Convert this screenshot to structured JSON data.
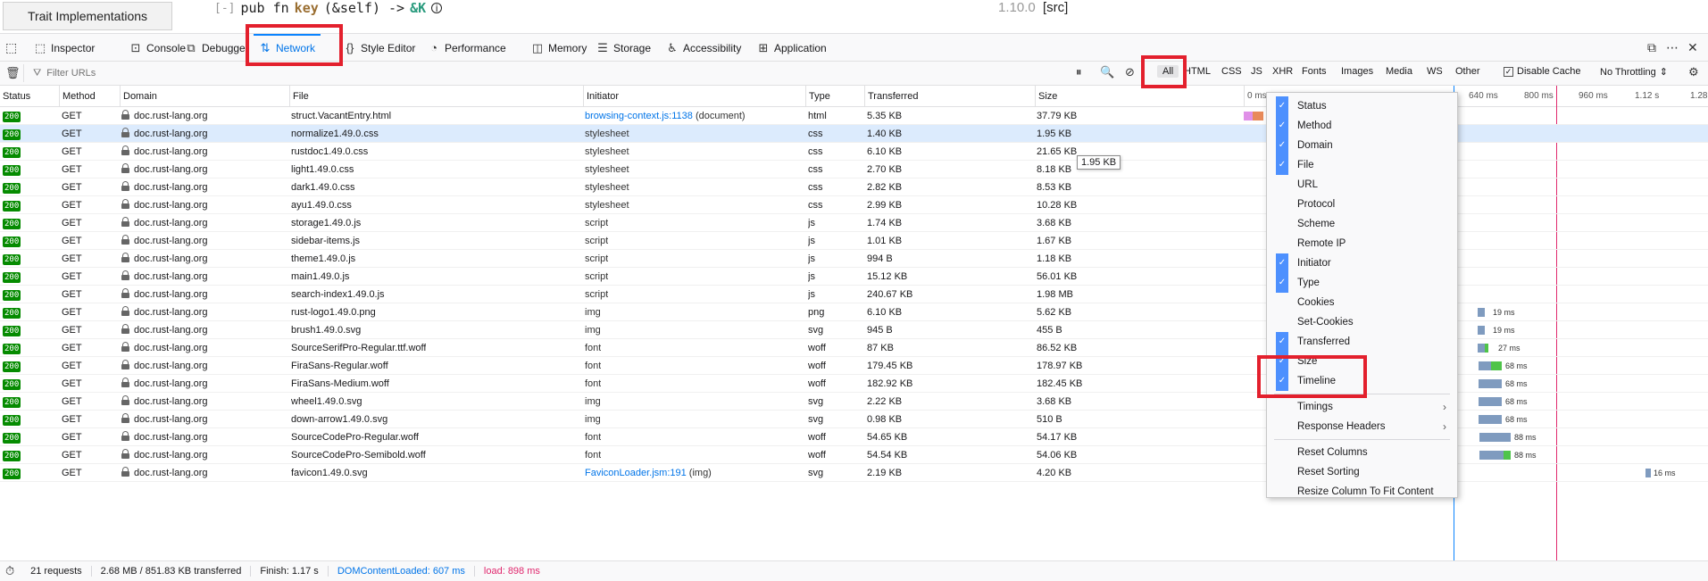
{
  "doc": {
    "sidebar_button": "Trait Implementations",
    "toggle": "[-]",
    "code_prefix": "pub fn",
    "fn_name": "key",
    "code_args": "(&self) ->",
    "ret_type": "&K",
    "info": "i",
    "version": "1.10.0",
    "src": "[src]"
  },
  "tabs": [
    {
      "label": "Inspector",
      "icon": "inspector-icon"
    },
    {
      "label": "Console",
      "icon": "console-icon"
    },
    {
      "label": "Debugger",
      "icon": "debugger-icon"
    },
    {
      "label": "Network",
      "icon": "network-icon",
      "active": true
    },
    {
      "label": "Style Editor",
      "icon": "style-editor-icon"
    },
    {
      "label": "Performance",
      "icon": "performance-icon"
    },
    {
      "label": "Memory",
      "icon": "memory-icon"
    },
    {
      "label": "Storage",
      "icon": "storage-icon"
    },
    {
      "label": "Accessibility",
      "icon": "accessibility-icon"
    },
    {
      "label": "Application",
      "icon": "application-icon"
    }
  ],
  "toolbar": {
    "filter_placeholder": "Filter URLs",
    "types": [
      "All",
      "HTML",
      "CSS",
      "JS",
      "XHR",
      "Fonts",
      "Images",
      "Media",
      "WS",
      "Other"
    ],
    "disable_cache": "Disable Cache",
    "throttling": "No Throttling"
  },
  "columns": {
    "status": "Status",
    "method": "Method",
    "domain": "Domain",
    "file": "File",
    "initiator": "Initiator",
    "type": "Type",
    "transferred": "Transferred",
    "size": "Size"
  },
  "waterfall_ticks": [
    "0 ms",
    "640 ms",
    "800 ms",
    "960 ms",
    "1.12 s",
    "1.28"
  ],
  "rows": [
    {
      "status": "200",
      "method": "GET",
      "domain": "doc.rust-lang.org",
      "file": "struct.VacantEntry.html",
      "initiator_link": "browsing-context.js:1138",
      "initiator_rest": "(document)",
      "type": "html",
      "transferred": "5.35 KB",
      "size": "37.79 KB",
      "timing": ""
    },
    {
      "status": "200",
      "method": "GET",
      "domain": "doc.rust-lang.org",
      "file": "normalize1.49.0.css",
      "initiator_link": "",
      "initiator_rest": "stylesheet",
      "type": "css",
      "transferred": "1.40 KB",
      "size": "1.95 KB",
      "timing": ""
    },
    {
      "status": "200",
      "method": "GET",
      "domain": "doc.rust-lang.org",
      "file": "rustdoc1.49.0.css",
      "initiator_link": "",
      "initiator_rest": "stylesheet",
      "type": "css",
      "transferred": "6.10 KB",
      "size": "21.65 KB",
      "timing": ""
    },
    {
      "status": "200",
      "method": "GET",
      "domain": "doc.rust-lang.org",
      "file": "light1.49.0.css",
      "initiator_link": "",
      "initiator_rest": "stylesheet",
      "type": "css",
      "transferred": "2.70 KB",
      "size": "8.18 KB",
      "timing": ""
    },
    {
      "status": "200",
      "method": "GET",
      "domain": "doc.rust-lang.org",
      "file": "dark1.49.0.css",
      "initiator_link": "",
      "initiator_rest": "stylesheet",
      "type": "css",
      "transferred": "2.82 KB",
      "size": "8.53 KB",
      "timing": ""
    },
    {
      "status": "200",
      "method": "GET",
      "domain": "doc.rust-lang.org",
      "file": "ayu1.49.0.css",
      "initiator_link": "",
      "initiator_rest": "stylesheet",
      "type": "css",
      "transferred": "2.99 KB",
      "size": "10.28 KB",
      "timing": ""
    },
    {
      "status": "200",
      "method": "GET",
      "domain": "doc.rust-lang.org",
      "file": "storage1.49.0.js",
      "initiator_link": "",
      "initiator_rest": "script",
      "type": "js",
      "transferred": "1.74 KB",
      "size": "3.68 KB",
      "timing": ""
    },
    {
      "status": "200",
      "method": "GET",
      "domain": "doc.rust-lang.org",
      "file": "sidebar-items.js",
      "initiator_link": "",
      "initiator_rest": "script",
      "type": "js",
      "transferred": "1.01 KB",
      "size": "1.67 KB",
      "timing": ""
    },
    {
      "status": "200",
      "method": "GET",
      "domain": "doc.rust-lang.org",
      "file": "theme1.49.0.js",
      "initiator_link": "",
      "initiator_rest": "script",
      "type": "js",
      "transferred": "994 B",
      "size": "1.18 KB",
      "timing": ""
    },
    {
      "status": "200",
      "method": "GET",
      "domain": "doc.rust-lang.org",
      "file": "main1.49.0.js",
      "initiator_link": "",
      "initiator_rest": "script",
      "type": "js",
      "transferred": "15.12 KB",
      "size": "56.01 KB",
      "timing": ""
    },
    {
      "status": "200",
      "method": "GET",
      "domain": "doc.rust-lang.org",
      "file": "search-index1.49.0.js",
      "initiator_link": "",
      "initiator_rest": "script",
      "type": "js",
      "transferred": "240.67 KB",
      "size": "1.98 MB",
      "timing": ""
    },
    {
      "status": "200",
      "method": "GET",
      "domain": "doc.rust-lang.org",
      "file": "rust-logo1.49.0.png",
      "initiator_link": "",
      "initiator_rest": "img",
      "type": "png",
      "transferred": "6.10 KB",
      "size": "5.62 KB",
      "timing": "19 ms"
    },
    {
      "status": "200",
      "method": "GET",
      "domain": "doc.rust-lang.org",
      "file": "brush1.49.0.svg",
      "initiator_link": "",
      "initiator_rest": "img",
      "type": "svg",
      "transferred": "945 B",
      "size": "455 B",
      "timing": "19 ms"
    },
    {
      "status": "200",
      "method": "GET",
      "domain": "doc.rust-lang.org",
      "file": "SourceSerifPro-Regular.ttf.woff",
      "initiator_link": "",
      "initiator_rest": "font",
      "type": "woff",
      "transferred": "87 KB",
      "size": "86.52 KB",
      "timing": "27 ms"
    },
    {
      "status": "200",
      "method": "GET",
      "domain": "doc.rust-lang.org",
      "file": "FiraSans-Regular.woff",
      "initiator_link": "",
      "initiator_rest": "font",
      "type": "woff",
      "transferred": "179.45 KB",
      "size": "178.97 KB",
      "timing": "68 ms"
    },
    {
      "status": "200",
      "method": "GET",
      "domain": "doc.rust-lang.org",
      "file": "FiraSans-Medium.woff",
      "initiator_link": "",
      "initiator_rest": "font",
      "type": "woff",
      "transferred": "182.92 KB",
      "size": "182.45 KB",
      "timing": "68 ms"
    },
    {
      "status": "200",
      "method": "GET",
      "domain": "doc.rust-lang.org",
      "file": "wheel1.49.0.svg",
      "initiator_link": "",
      "initiator_rest": "img",
      "type": "svg",
      "transferred": "2.22 KB",
      "size": "3.68 KB",
      "timing": "68 ms"
    },
    {
      "status": "200",
      "method": "GET",
      "domain": "doc.rust-lang.org",
      "file": "down-arrow1.49.0.svg",
      "initiator_link": "",
      "initiator_rest": "img",
      "type": "svg",
      "transferred": "0.98 KB",
      "size": "510 B",
      "timing": "68 ms"
    },
    {
      "status": "200",
      "method": "GET",
      "domain": "doc.rust-lang.org",
      "file": "SourceCodePro-Regular.woff",
      "initiator_link": "",
      "initiator_rest": "font",
      "type": "woff",
      "transferred": "54.65 KB",
      "size": "54.17 KB",
      "timing": "88 ms"
    },
    {
      "status": "200",
      "method": "GET",
      "domain": "doc.rust-lang.org",
      "file": "SourceCodePro-Semibold.woff",
      "initiator_link": "",
      "initiator_rest": "font",
      "type": "woff",
      "transferred": "54.54 KB",
      "size": "54.06 KB",
      "timing": "88 ms"
    },
    {
      "status": "200",
      "method": "GET",
      "domain": "doc.rust-lang.org",
      "file": "favicon1.49.0.svg",
      "initiator_link": "FaviconLoader.jsm:191",
      "initiator_rest": "(img)",
      "type": "svg",
      "transferred": "2.19 KB",
      "size": "4.20 KB",
      "timing": "16 ms"
    }
  ],
  "tooltip": "1.95 KB",
  "menu": {
    "items": [
      {
        "label": "Status",
        "checked": true
      },
      {
        "label": "Method",
        "checked": true
      },
      {
        "label": "Domain",
        "checked": true
      },
      {
        "label": "File",
        "checked": true
      },
      {
        "label": "URL",
        "checked": false
      },
      {
        "label": "Protocol",
        "checked": false
      },
      {
        "label": "Scheme",
        "checked": false
      },
      {
        "label": "Remote IP",
        "checked": false
      },
      {
        "label": "Initiator",
        "checked": true
      },
      {
        "label": "Type",
        "checked": true
      },
      {
        "label": "Cookies",
        "checked": false
      },
      {
        "label": "Set-Cookies",
        "checked": false
      },
      {
        "label": "Transferred",
        "checked": true
      },
      {
        "label": "Size",
        "checked": true
      },
      {
        "label": "Timeline",
        "checked": true
      }
    ],
    "submenus": [
      "Timings",
      "Response Headers"
    ],
    "actions": [
      "Reset Columns",
      "Reset Sorting",
      "Resize Column To Fit Content"
    ]
  },
  "footer": {
    "requests": "21 requests",
    "transferred": "2.68 MB / 851.83 KB transferred",
    "finish": "Finish: 1.17 s",
    "dcl": "DOMContentLoaded: 607 ms",
    "load": "load: 898 ms"
  },
  "colors": {
    "accent": "#0a84ff",
    "status_ok": "#058b00",
    "highlight": "#e3202d",
    "load_line": "#e0286e"
  }
}
